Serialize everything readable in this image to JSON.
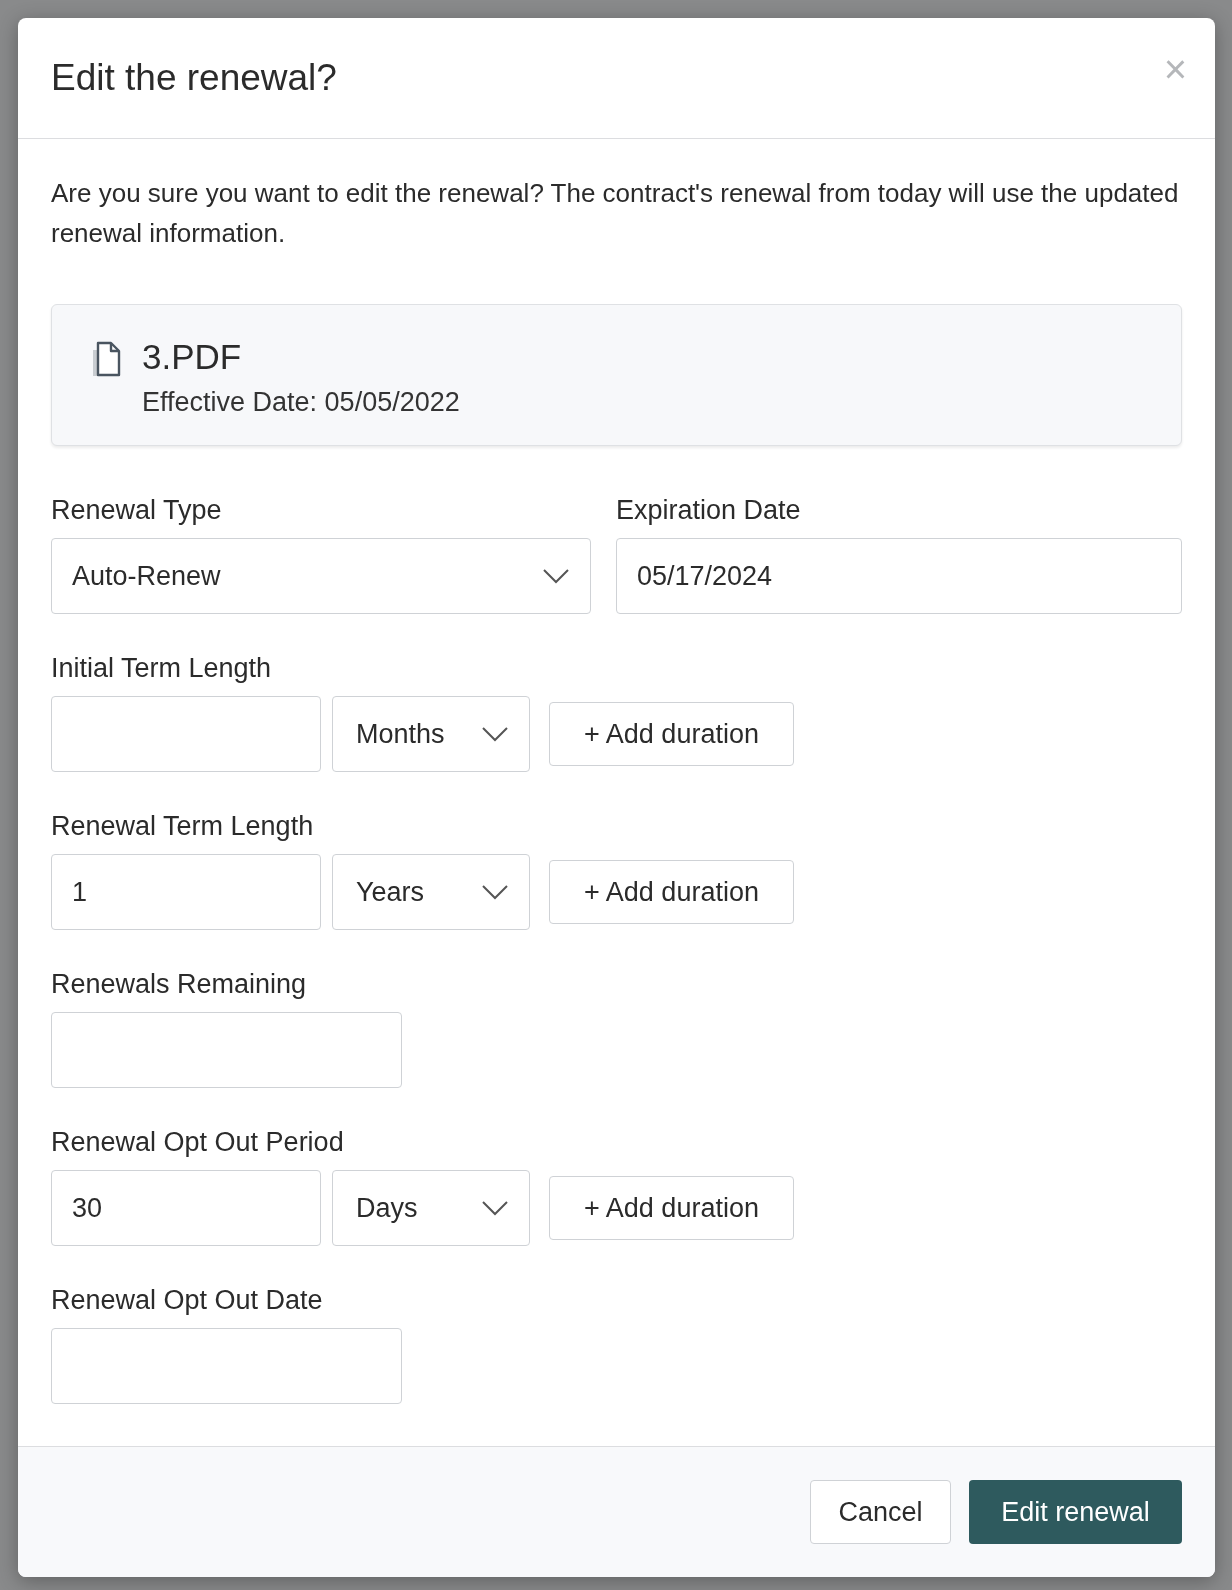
{
  "dialog": {
    "title": "Edit the renewal?",
    "close": "×",
    "message": "Are you sure you want to edit the renewal? The contract's renewal from today will use the updated renewal information.",
    "document": {
      "name": "3.PDF",
      "effective_date": "Effective Date: 05/05/2022"
    },
    "rows": [
      {
        "fields": [
          {
            "kind": "select",
            "label": "Renewal Type",
            "value": "Auto-Renew"
          },
          {
            "kind": "text",
            "label": "Expiration Date",
            "value": "05/17/2024"
          }
        ]
      },
      {
        "fields": [
          {
            "kind": "duration",
            "label": "Initial Term Length",
            "unit": "Months",
            "add_button": "+ Add duration"
          }
        ]
      },
      {
        "fields": [
          {
            "kind": "duration",
            "label": "Renewal Term Length",
            "amount": "1",
            "unit": "Years",
            "add_button": "+ Add duration"
          }
        ]
      },
      {
        "fields": [
          {
            "kind": "text",
            "label": "Renewals Remaining"
          }
        ]
      },
      {
        "fields": [
          {
            "kind": "duration",
            "label": "Renewal Opt Out Period",
            "amount": "30",
            "unit": "Days",
            "add_button": "+ Add duration"
          }
        ]
      },
      {
        "fields": [
          {
            "kind": "text",
            "label": "Renewal Opt Out Date"
          }
        ]
      }
    ],
    "buttons": [
      {
        "kind": "secondary",
        "label": "Cancel"
      },
      {
        "kind": "primary",
        "label": "Edit renewal"
      }
    ]
  }
}
